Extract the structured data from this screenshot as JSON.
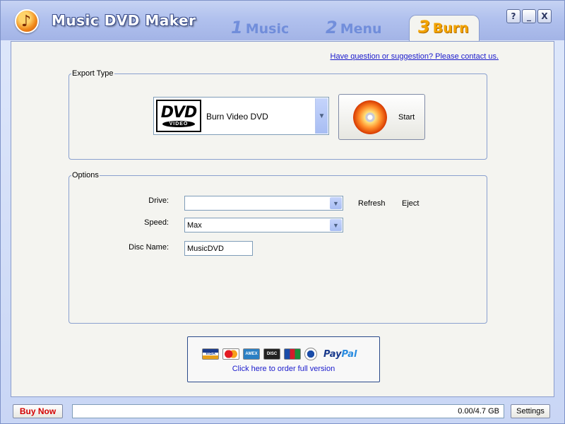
{
  "window": {
    "title": "Music DVD Maker",
    "buttons": {
      "help": "?",
      "minimize": "_",
      "close": "X"
    }
  },
  "steps": [
    {
      "num": "1",
      "label": "Music",
      "active": false
    },
    {
      "num": "2",
      "label": "Menu",
      "active": false
    },
    {
      "num": "3",
      "label": "Burn",
      "active": true
    }
  ],
  "contact_link": "Have question or suggestion? Please contact us.",
  "export": {
    "legend": "Export Type",
    "selected": "Burn Video DVD",
    "logo_text": "DVD",
    "logo_subtext": "VIDEO",
    "start_label": "Start"
  },
  "options": {
    "legend": "Options",
    "drive_label": "Drive:",
    "drive_value": "",
    "speed_label": "Speed:",
    "speed_value": "Max",
    "disc_name_label": "Disc Name:",
    "disc_name_value": "MusicDVD",
    "refresh_label": "Refresh",
    "eject_label": "Eject"
  },
  "order": {
    "link_text": "Click here to order full version",
    "cards": [
      "VISA",
      "MC",
      "AMEX",
      "DISC",
      "JCB",
      "DC"
    ],
    "paypal_pay": "Pay",
    "paypal_pal": "Pal"
  },
  "statusbar": {
    "buy_label": "Buy Now",
    "capacity_text": "0.00/4.7 GB",
    "capacity_used_fraction": 0,
    "settings_label": "Settings"
  },
  "colors": {
    "buy_now": "#d40000",
    "active_tab": "#f2a300",
    "link": "#1a1acc"
  }
}
